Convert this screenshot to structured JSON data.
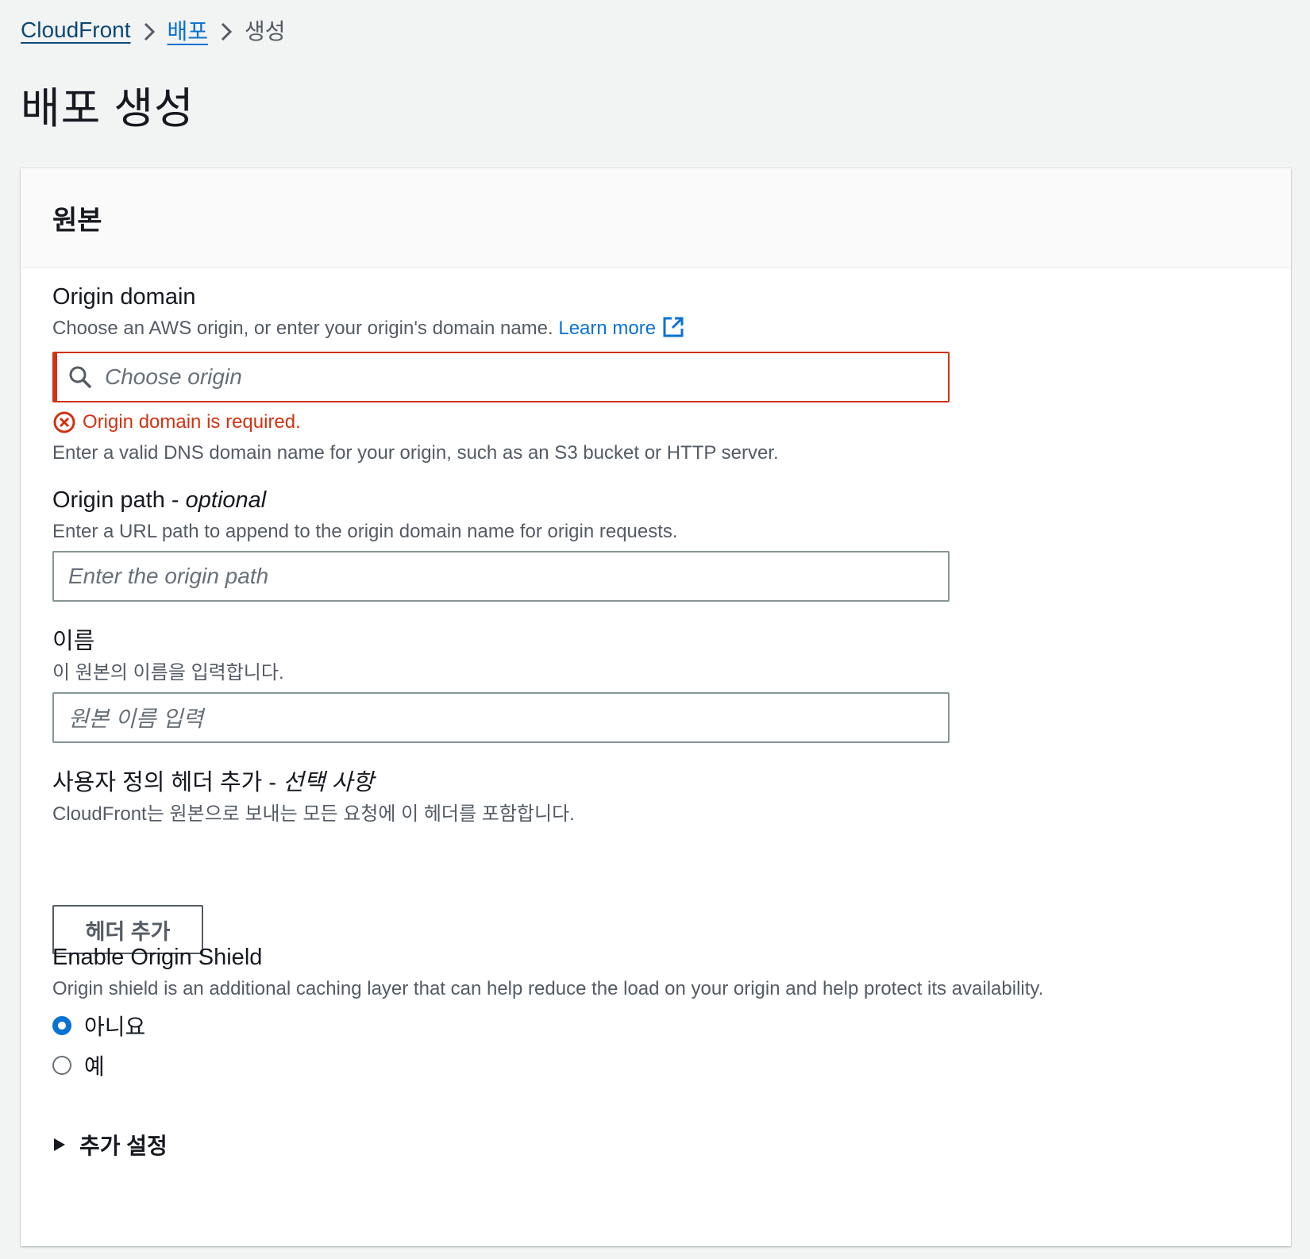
{
  "breadcrumb": {
    "items": [
      "CloudFront",
      "배포"
    ],
    "current": "생성"
  },
  "page_title": "배포 생성",
  "panel": {
    "title": "원본",
    "origin_domain": {
      "label": "Origin domain",
      "description": "Choose an AWS origin, or enter your origin's domain name.",
      "learn_more": "Learn more",
      "placeholder": "Choose origin",
      "error": "Origin domain is required.",
      "hint": "Enter a valid DNS domain name for your origin, such as an S3 bucket or HTTP server."
    },
    "origin_path": {
      "label": "Origin path - ",
      "label_optional": "optional",
      "description": "Enter a URL path to append to the origin domain name for origin requests.",
      "placeholder": "Enter the origin path"
    },
    "name": {
      "label": "이름",
      "description": "이 원본의 이름을 입력합니다.",
      "placeholder": "원본 이름 입력"
    },
    "custom_headers": {
      "label": "사용자 정의 헤더 추가 - ",
      "label_optional": "선택 사항",
      "description": "CloudFront는 원본으로 보내는 모든 요청에 이 헤더를 포함합니다.",
      "button": "헤더 추가"
    },
    "origin_shield": {
      "label": "Enable Origin Shield",
      "description": "Origin shield is an additional caching layer that can help reduce the load on your origin and help protect its availability.",
      "options": [
        "아니요",
        "예"
      ],
      "selected": "아니요"
    },
    "additional_settings": "추가 설정"
  },
  "colors": {
    "link": "#0972d3",
    "error": "#d13212",
    "background": "#f2f3f3"
  }
}
